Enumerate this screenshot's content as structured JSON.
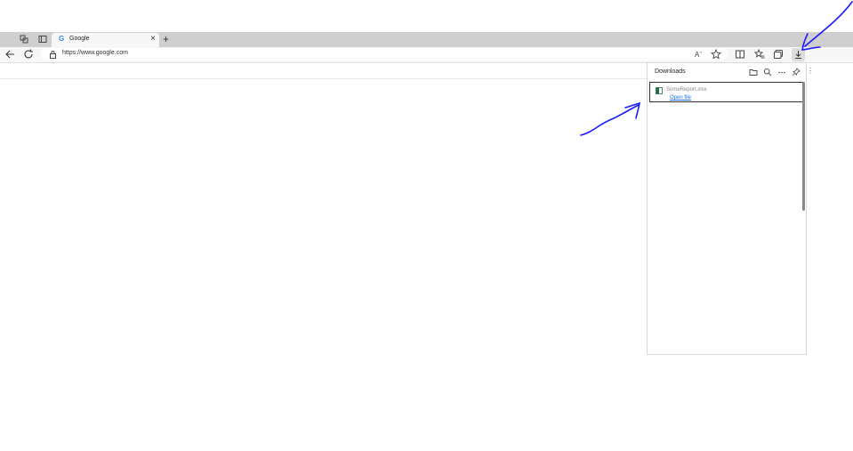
{
  "tab": {
    "favicon_letter": "G",
    "title": "Google",
    "close_glyph": "×"
  },
  "new_tab_glyph": "+",
  "address_bar": {
    "url": "https://www.google.com"
  },
  "downloads_panel": {
    "title": "Downloads",
    "items": [
      {
        "file_name": "SomeReport.xlsx",
        "action_label": "Open file"
      }
    ]
  },
  "icons": {
    "workspaces": "workspaces-icon",
    "tab_actions": "tab-actions-icon",
    "back": "back-arrow-icon",
    "refresh": "refresh-icon",
    "lock": "lock-icon",
    "read_aloud": "read-aloud-icon",
    "favorite": "star-icon",
    "split_screen": "split-screen-icon",
    "favorites": "favorites-icon",
    "collections": "collections-icon",
    "downloads": "download-icon",
    "open_folder": "folder-icon",
    "search": "search-icon",
    "more": "more-icon",
    "pin": "pin-icon",
    "excel_file": "excel-file-icon"
  },
  "colors": {
    "tabstrip": "#cfcfcf",
    "toolbar": "#f7f7f7",
    "link": "#1a73e8",
    "annotation": "#1a1aff",
    "excel_green": "#1d6f42"
  }
}
